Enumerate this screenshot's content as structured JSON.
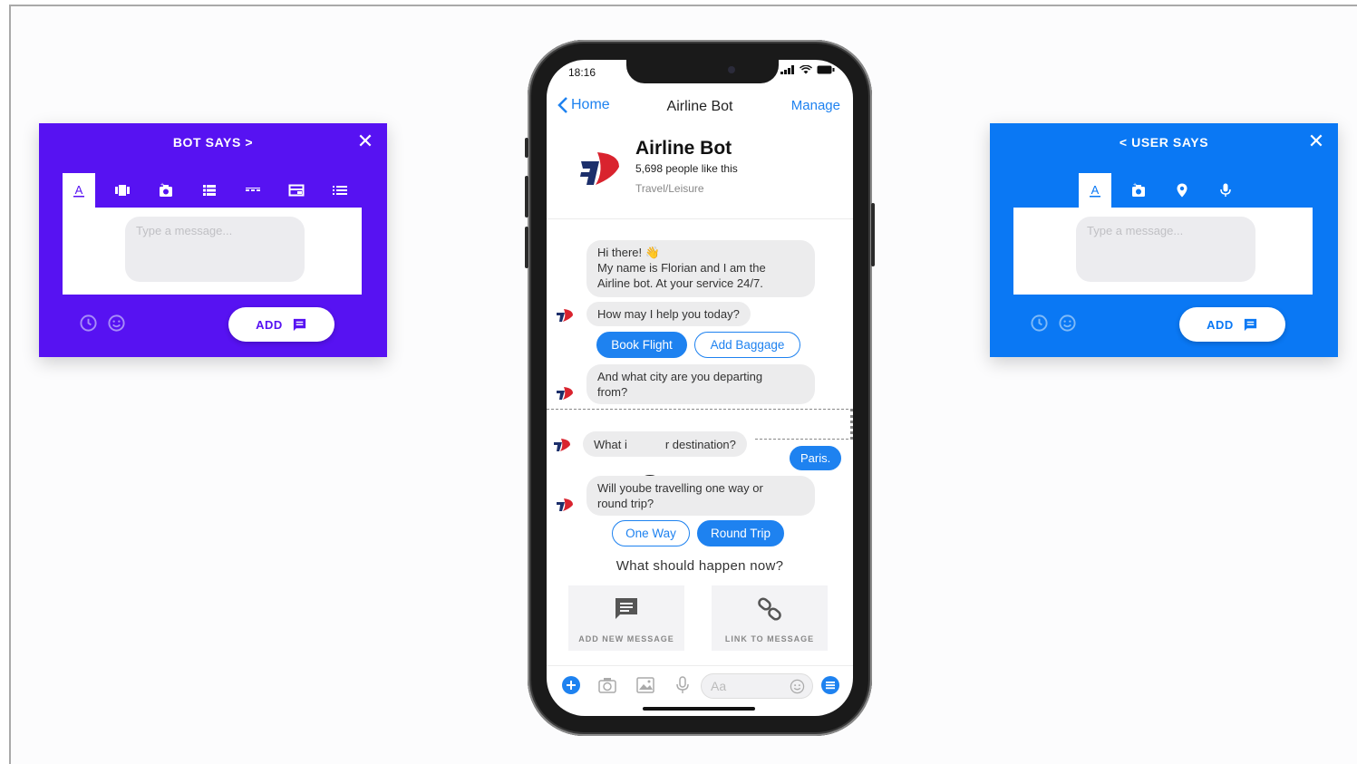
{
  "bot_panel": {
    "title": "BOT SAYS >",
    "placeholder": "Type a message...",
    "add_label": "ADD",
    "color": "#5712f2",
    "tabs": [
      "text-icon",
      "carousel-icon",
      "camera-icon",
      "list-icon",
      "divider-icon",
      "card-icon",
      "menu-icon"
    ]
  },
  "user_panel": {
    "title": "< USER SAYS",
    "placeholder": "Type a message...",
    "add_label": "ADD",
    "color": "#0a78f4",
    "tabs": [
      "text-icon",
      "camera-icon",
      "location-icon",
      "microphone-icon"
    ]
  },
  "phone": {
    "time": "18:16",
    "nav": {
      "back": "Home",
      "title": "Airline Bot",
      "action": "Manage"
    },
    "profile": {
      "name": "Airline Bot",
      "likes": "5,698 people like this",
      "category": "Travel/Leisure"
    },
    "messages": {
      "greeting": "Hi there! 👋",
      "intro_1": "My name is Florian and I am the",
      "intro_2": "Airline bot. At your service 24/7.",
      "help": "How may I help you today?",
      "depart_1": "And what city are you departing",
      "depart_2": "from?",
      "dest_a": "What i",
      "dest_b": "r destination?",
      "user_reply": "Paris.",
      "trip_1": "Will yoube travelling one way or",
      "trip_2": "round trip?"
    },
    "quick_replies": {
      "book": "Book Flight",
      "baggage": "Add Baggage",
      "one_way": "One Way",
      "round_trip": "Round Trip"
    },
    "prompt": "What should happen now?",
    "actions": {
      "add": "ADD NEW MESSAGE",
      "link": "LINK TO MESSAGE"
    },
    "composer_placeholder": "Aa",
    "accent": "#1e82f0"
  }
}
